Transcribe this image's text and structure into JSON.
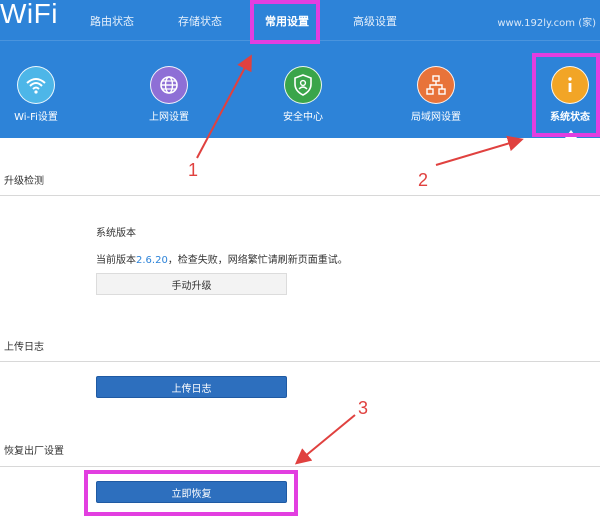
{
  "header": {
    "brand": "WiFi",
    "site": "www.192ly.com (家)",
    "top_tabs": [
      {
        "label": "路由状态"
      },
      {
        "label": "存储状态"
      },
      {
        "label": "常用设置"
      },
      {
        "label": "高级设置"
      }
    ],
    "nav_items": [
      {
        "label": "Wi-Fi设置",
        "icon": "wifi-icon",
        "color": "#4db6e8"
      },
      {
        "label": "上网设置",
        "icon": "globe-icon",
        "color": "#8e6fd6"
      },
      {
        "label": "安全中心",
        "icon": "shield-icon",
        "color": "#3aa54a"
      },
      {
        "label": "局域网设置",
        "icon": "network-icon",
        "color": "#e8733a"
      },
      {
        "label": "系统状态",
        "icon": "info-icon",
        "color": "#f2a526"
      }
    ]
  },
  "upgrade": {
    "title": "升级检测",
    "system_version_label": "系统版本",
    "current_prefix": "当前版本",
    "version": "2.6.20",
    "status_text": "，检查失败，网络繁忙请刷新页面重试。",
    "button": "手动升级"
  },
  "log": {
    "title": "上传日志",
    "button": "上传日志"
  },
  "restore": {
    "title": "恢复出厂设置",
    "button": "立即恢复"
  },
  "annotations": {
    "step1": "1",
    "step2": "2",
    "step3": "3",
    "highlight_color": "#e23ee0",
    "arrow_color": "#e0413f"
  },
  "colors": {
    "header_bg": "#2d83d8",
    "primary_button": "#2d6fbe"
  }
}
